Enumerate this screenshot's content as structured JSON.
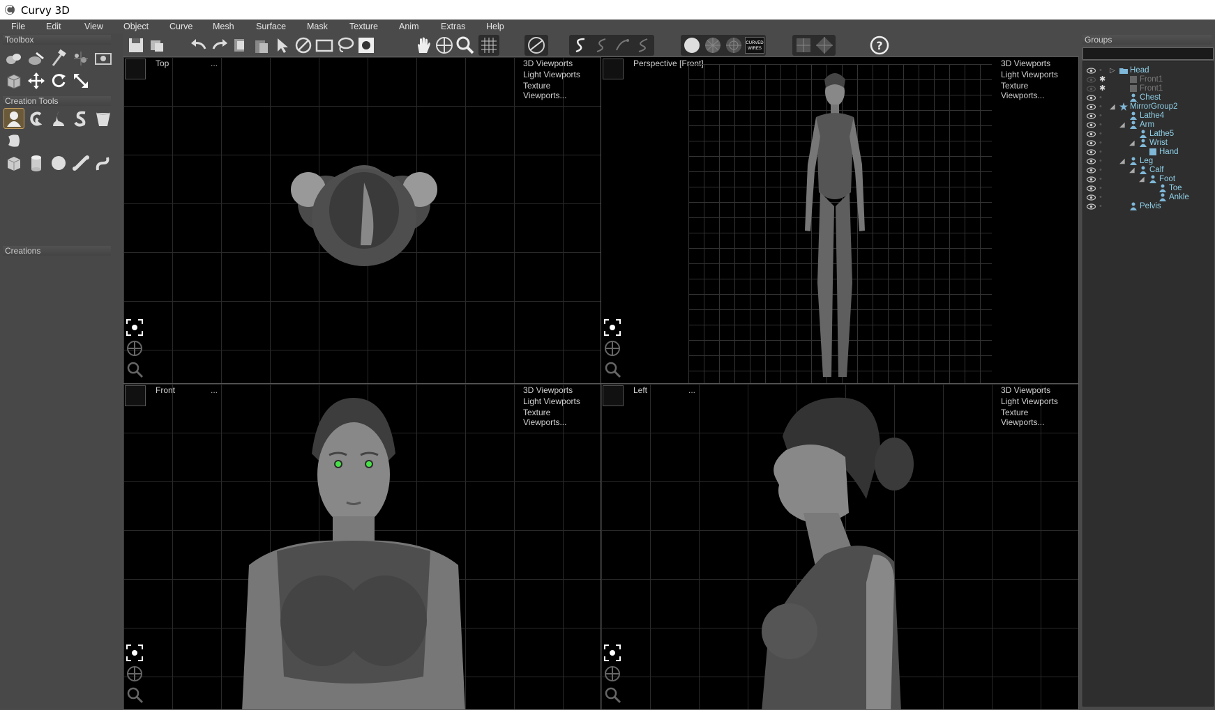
{
  "app": {
    "title": "Curvy 3D"
  },
  "menu": [
    "File",
    "Edit",
    "View",
    "Object",
    "Curve",
    "Mesh",
    "Surface",
    "Mask",
    "Texture",
    "Anim",
    "Extras",
    "Help"
  ],
  "left": {
    "toolbox_label": "Toolbox",
    "creation_tools_label": "Creation Tools",
    "creations_label": "Creations"
  },
  "toolbar": {
    "curved_wires_label": "CURVED WIRES",
    "help_label": "?"
  },
  "viewport_menu": {
    "item1": "3D Viewports",
    "item2": "Light Viewports",
    "item3": "Texture Viewports...",
    "dots": "..."
  },
  "viewports": {
    "top_left": {
      "label": "Top"
    },
    "top_right": {
      "label": "Perspective [Front]"
    },
    "bottom_left": {
      "label": "Front"
    },
    "bottom_right": {
      "label": "Left"
    }
  },
  "groups": {
    "label": "Groups",
    "items": [
      {
        "label": "Head",
        "type": "folder",
        "dim": false
      },
      {
        "label": "Front1",
        "type": "plane",
        "dim": true
      },
      {
        "label": "Front1",
        "type": "plane",
        "dim": true
      },
      {
        "label": "Chest",
        "type": "figure",
        "dim": false
      },
      {
        "label": "MirrorGroup2",
        "type": "star",
        "dim": false
      },
      {
        "label": "Lathe4",
        "type": "figure",
        "dim": false
      },
      {
        "label": "Arm",
        "type": "figure",
        "dim": false
      },
      {
        "label": "Lathe5",
        "type": "figure",
        "dim": false
      },
      {
        "label": "Wrist",
        "type": "figure",
        "dim": false
      },
      {
        "label": "Hand",
        "type": "box",
        "dim": false
      },
      {
        "label": "Leg",
        "type": "figure",
        "dim": false
      },
      {
        "label": "Calf",
        "type": "figure",
        "dim": false
      },
      {
        "label": "Foot",
        "type": "figure",
        "dim": false
      },
      {
        "label": "Toe",
        "type": "figure",
        "dim": false
      },
      {
        "label": "Ankle",
        "type": "figure",
        "dim": false
      },
      {
        "label": "Pelvis",
        "type": "figure",
        "dim": false
      }
    ]
  },
  "colors": {
    "panel_bg": "#4a4a4a",
    "viewport_bg": "#000000",
    "tree_text": "#8fd0e8",
    "eye_color": "#48e048"
  }
}
